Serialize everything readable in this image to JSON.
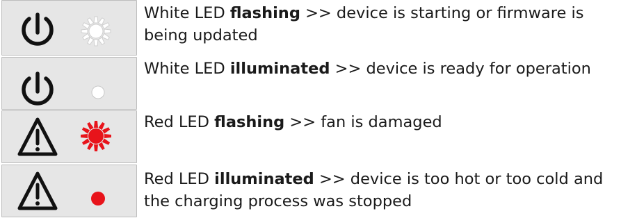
{
  "led_states": [
    {
      "status_icon": "power-icon",
      "led_icon": "led-flashing-icon",
      "led_color": "#ffffff",
      "led_mode": "flashing",
      "prefix": "White LED",
      "emphasis": "flashing",
      "suffix": ">> device is starting or firmware is being updated"
    },
    {
      "status_icon": "power-icon",
      "led_icon": "led-steady-icon",
      "led_color": "#ffffff",
      "led_mode": "illuminated",
      "prefix": "White LED",
      "emphasis": "illuminated",
      "suffix": ">> device is ready for operation"
    },
    {
      "status_icon": "warning-triangle-icon",
      "led_icon": "led-flashing-icon",
      "led_color": "#e8141b",
      "led_mode": "flashing",
      "prefix": "Red LED",
      "emphasis": "flashing",
      "suffix": ">> fan is damaged"
    },
    {
      "status_icon": "warning-triangle-icon",
      "led_icon": "led-steady-icon",
      "led_color": "#e8141b",
      "led_mode": "illuminated",
      "prefix": "Red LED",
      "emphasis": "illuminated",
      "suffix": ">> device is too hot or too cold and the charging process was stopped"
    }
  ]
}
